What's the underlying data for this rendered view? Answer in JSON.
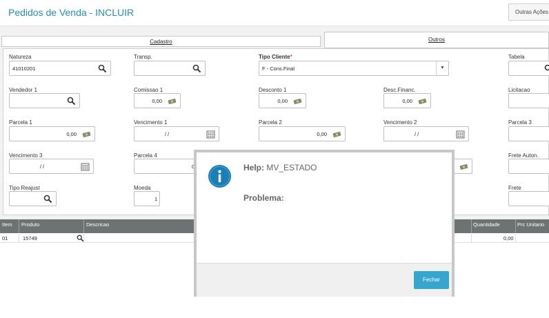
{
  "header": {
    "title": "Pedidos de Venda - INCLUIR",
    "actions_label": "Outras Ações"
  },
  "tabs": [
    {
      "label": "Cadastro"
    },
    {
      "label": "Outros"
    }
  ],
  "fields": {
    "natureza": {
      "label": "Natureza",
      "value": "41010201"
    },
    "transp": {
      "label": "Transp.",
      "value": ""
    },
    "tipo_cliente": {
      "label": "Tipo Cliente",
      "required": "*",
      "value": "F - Cons.Final"
    },
    "tabela": {
      "label": "Tabela",
      "value": ""
    },
    "vendedor1": {
      "label": "Vendedor 1",
      "value": ""
    },
    "comissao1": {
      "label": "Comissao 1",
      "value": "0,00"
    },
    "desconto1": {
      "label": "Desconto 1",
      "value": "0,00"
    },
    "desc_financ": {
      "label": "Desc.Financ.",
      "value": "0,00"
    },
    "licitacao": {
      "label": "Licitacao",
      "value": ""
    },
    "parcela1": {
      "label": "Parcela 1",
      "value": "0,00"
    },
    "vencimento1": {
      "label": "Vencimento 1",
      "value": "/ /"
    },
    "parcela2": {
      "label": "Parcela 2",
      "value": "0,00"
    },
    "vencimento2": {
      "label": "Vencimento 2",
      "value": "/ /"
    },
    "parcela3": {
      "label": "Parcela 3",
      "value": ""
    },
    "vencimento3": {
      "label": "Vencimento 3",
      "value": "/ /"
    },
    "parcela4": {
      "label": "Parcela 4",
      "value": "0"
    },
    "frete_auton": {
      "label": "Frete Auton.",
      "value": ""
    },
    "tipo_reajust": {
      "label": "Tipo Reajust",
      "value": ""
    },
    "moeda": {
      "label": "Moeda",
      "value": "1"
    },
    "frete": {
      "label": "Frete",
      "value": ""
    }
  },
  "grid": {
    "columns": [
      "Item",
      "Produto",
      "Descricao",
      "Quantidade",
      "Prc Unitario"
    ],
    "rows": [
      {
        "item": "01",
        "produto": "15749",
        "descricao": "",
        "quantidade": "0,00",
        "prc_unitario": ""
      }
    ]
  },
  "modal": {
    "help_label": "Help:",
    "help_code": "MV_ESTADO",
    "problem_label": "Problema:",
    "close_label": "Fechar"
  },
  "colors": {
    "accent": "#1f8fc4",
    "button": "#37a6cf",
    "grid_header": "#6d7273",
    "info_icon": "#1a7fb8"
  }
}
